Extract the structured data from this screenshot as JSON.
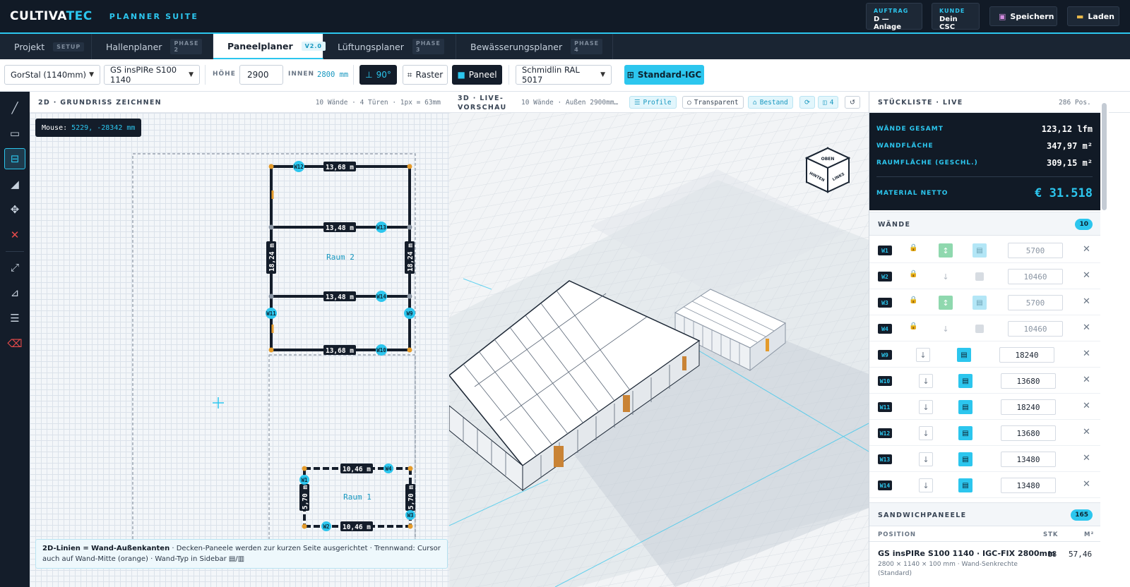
{
  "header": {
    "logo_main": "CULTIVA",
    "logo_accent": "TEC",
    "suite": "PLANNER SUITE",
    "auftrag_label": "AUFTRAG",
    "auftrag_value": "D — Anlage",
    "kunde_label": "KUNDE",
    "kunde_value": "Dein CSC",
    "save_label": "Speichern",
    "load_label": "Laden"
  },
  "tabs": [
    {
      "label": "Projekt",
      "badge": "SETUP"
    },
    {
      "label": "Hallenplaner",
      "badge": "PHASE 2"
    },
    {
      "label": "Paneelplaner",
      "badge": "V2.0"
    },
    {
      "label": "Lüftungsplaner",
      "badge": "PHASE 3"
    },
    {
      "label": "Bewässerungsplaner",
      "badge": "PHASE 4"
    }
  ],
  "toolbar": {
    "profile_select": "GorStal (1140mm)",
    "panel_select": "GS insPIRe S100 1140",
    "height_label": "HÖHE",
    "height_value": "2900",
    "inner_label": "INNEN",
    "inner_value": "2800 mm",
    "angle_label": "90°",
    "raster_label": "Raster",
    "paneel_label": "Paneel",
    "color_select": "Schmidlin RAL 5017",
    "standard_label": "Standard-IGC"
  },
  "plan2d": {
    "title": "2D · GRUNDRISS ZEICHNEN",
    "stats": "10 Wände · 4 Türen · 1px = 63mm",
    "mouse_label": "Mouse:",
    "mouse_value": "5229, -28342 mm",
    "room2_label": "Raum 2",
    "room1_label": "Raum 1",
    "dims": {
      "top": "13,68 m",
      "mid1": "13,48 m",
      "mid2": "13,48 m",
      "bottom": "13,68 m",
      "left": "18,24 m",
      "right": "18,24 m",
      "r1_top": "10,46 m",
      "r1_bottom": "10,46 m",
      "r1_right": "5,70 m",
      "r1_left": "5,70 m"
    },
    "wall_ids": {
      "w12": "W12",
      "w13": "W13",
      "w14": "W14",
      "w10": "W10",
      "w11": "W11",
      "w9": "W9",
      "w1": "W1",
      "w2": "W2",
      "w3": "W3",
      "w4": "W4"
    },
    "hint_bold": "2D-Linien = Wand-Außenkanten",
    "hint_text": " · Decken-Paneele werden zur kurzen Seite ausgerichtet · Trennwand: Cursor auch auf Wand-Mitte (orange) · Wand-Typ in Sidebar ▤/▥"
  },
  "view3d": {
    "title_line1": "3D · LIVE-",
    "title_line2": "VORSCHAU",
    "stats": "10 Wände · Außen 2900mm…",
    "chip_profile": "Profile",
    "chip_transparent": "Transparent",
    "chip_bestand": "Bestand",
    "chip_split": "4",
    "cube_top": "OBEN",
    "cube_left": "HINTEN",
    "cube_right": "LINKS"
  },
  "stueckliste": {
    "title": "STÜCKLISTE · LIVE",
    "pos_count": "286 Pos.",
    "summary": [
      {
        "label": "WÄNDE GESAMT",
        "value": "123,12 lfm"
      },
      {
        "label": "WANDFLÄCHE",
        "value": "347,97 m²"
      },
      {
        "label": "RAUMFLÄCHE (GESCHL.)",
        "value": "309,15 m²"
      }
    ],
    "material_label": "MATERIAL NETTO",
    "material_value": "€ 31.518",
    "walls_title": "WÄNDE",
    "walls_count": "10",
    "walls": [
      {
        "id": "W1",
        "length": "5700"
      },
      {
        "id": "W2",
        "length": "10460"
      },
      {
        "id": "W3",
        "length": "5700"
      },
      {
        "id": "W4",
        "length": "10460"
      },
      {
        "id": "W9",
        "length": "18240"
      },
      {
        "id": "W10",
        "length": "13680"
      },
      {
        "id": "W11",
        "length": "18240"
      },
      {
        "id": "W12",
        "length": "13680"
      },
      {
        "id": "W13",
        "length": "13480"
      },
      {
        "id": "W14",
        "length": "13480"
      }
    ],
    "panels_title": "SANDWICHPANEELE",
    "panels_count": "165",
    "col_position": "POSITION",
    "col_stk": "STK",
    "col_m2": "M²",
    "panel_rows": [
      {
        "name": "GS insPIRe S100 1140 · IGC-FIX 2800mm",
        "sub": "2800 × 1140 × 100 mm · Wand-Senkrechte",
        "sub2": "(Standard)",
        "stk": "18",
        "m2": "57,46"
      }
    ]
  },
  "colors": {
    "accent": "#2cc6ee",
    "dark": "#111a26",
    "orange": "#e49b2b"
  }
}
